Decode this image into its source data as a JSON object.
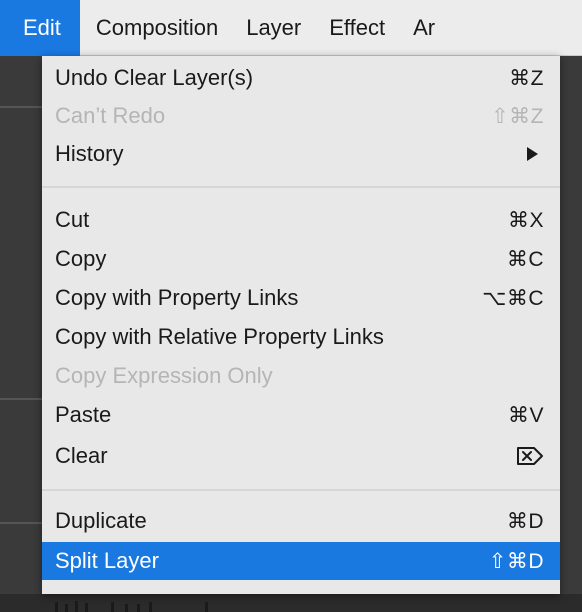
{
  "menubar": {
    "items": [
      "Edit",
      "Composition",
      "Layer",
      "Effect",
      "Ar"
    ],
    "active_index": 0
  },
  "edit_menu": {
    "undo": {
      "label": "Undo Clear Layer(s)",
      "shortcut": "⌘Z"
    },
    "redo": {
      "label": "Can’t Redo",
      "shortcut": "⇧⌘Z"
    },
    "history": {
      "label": "History"
    },
    "cut": {
      "label": "Cut",
      "shortcut": "⌘X"
    },
    "copy": {
      "label": "Copy",
      "shortcut": "⌘C"
    },
    "copy_links": {
      "label": "Copy with Property Links",
      "shortcut": "⌥⌘C"
    },
    "copy_rel_links": {
      "label": "Copy with Relative Property Links"
    },
    "copy_expr": {
      "label": "Copy Expression Only"
    },
    "paste": {
      "label": "Paste",
      "shortcut": "⌘V"
    },
    "clear": {
      "label": "Clear",
      "icon": "delete-forward-icon"
    },
    "duplicate": {
      "label": "Duplicate",
      "shortcut": "⌘D"
    },
    "split_layer": {
      "label": "Split Layer",
      "shortcut": "⇧⌘D"
    }
  },
  "colors": {
    "highlight": "#1a78e1",
    "menu_bg": "#e8e8e8",
    "disabled_text": "#b5b5b5"
  }
}
